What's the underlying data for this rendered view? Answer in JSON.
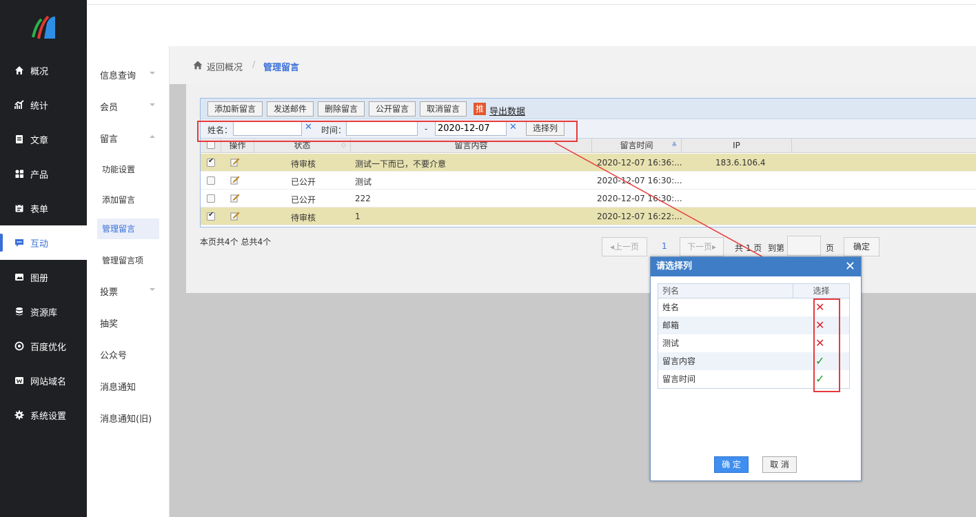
{
  "nav": {
    "items": [
      {
        "label": "概况",
        "icon": "home-icon"
      },
      {
        "label": "统计",
        "icon": "chart-icon"
      },
      {
        "label": "文章",
        "icon": "article-icon"
      },
      {
        "label": "产品",
        "icon": "grid-icon"
      },
      {
        "label": "表单",
        "icon": "form-icon"
      },
      {
        "label": "互动",
        "icon": "chat-icon"
      },
      {
        "label": "图册",
        "icon": "album-icon"
      },
      {
        "label": "资源库",
        "icon": "database-icon"
      },
      {
        "label": "百度优化",
        "icon": "seo-icon"
      },
      {
        "label": "网站域名",
        "icon": "domain-icon"
      },
      {
        "label": "系统设置",
        "icon": "gear-icon"
      }
    ],
    "active_index": 5
  },
  "subnav": {
    "info": "信息查询",
    "member": "会员",
    "message": "留言",
    "children": [
      "功能设置",
      "添加留言",
      "管理留言",
      "管理留言项"
    ],
    "vote": "投票",
    "lottery": "抽奖",
    "wechat": "公众号",
    "notice": "消息通知",
    "notice_old": "消息通知(旧)"
  },
  "breadcrumb": {
    "home": "返回概况",
    "sep": "/",
    "current": "管理留言"
  },
  "toolbar": {
    "add": "添加新留言",
    "email": "发送邮件",
    "delete": "删除留言",
    "publish": "公开留言",
    "unpublish": "取消留言",
    "export_badge": "推",
    "export": "导出数据"
  },
  "search": {
    "name_label": "姓名：",
    "time_label": "时间：",
    "dash": "-",
    "date_end": "2020-12-07",
    "choose_cols": "选择列"
  },
  "columns": {
    "op": "操作",
    "status": "状态",
    "content": "留言内容",
    "time": "留言时间",
    "ip": "IP"
  },
  "rows": [
    {
      "checked": true,
      "status": "待审核",
      "content": "测试一下而已，不要介意",
      "time": "2020-12-07 16:36:...",
      "ip": "183.6.106.4"
    },
    {
      "checked": false,
      "status": "已公开",
      "content": "测试",
      "time": "2020-12-07 16:30:...",
      "ip": ""
    },
    {
      "checked": false,
      "status": "已公开",
      "content": "222",
      "time": "2020-12-07 16:30:...",
      "ip": ""
    },
    {
      "checked": true,
      "status": "待审核",
      "content": "1",
      "time": "2020-12-07 16:22:...",
      "ip": ""
    }
  ],
  "pager": {
    "summary": "本页共4个 总共4个",
    "prev": "上一页",
    "page": "1",
    "next": "下一页",
    "total": "共 1 页",
    "goto": "到第",
    "unit": "页",
    "confirm": "确定"
  },
  "dialog": {
    "title": "请选择列",
    "col_name": "列名",
    "col_select": "选择",
    "items": [
      {
        "label": "姓名",
        "selected": false
      },
      {
        "label": "邮箱",
        "selected": false
      },
      {
        "label": "测试",
        "selected": false
      },
      {
        "label": "留言内容",
        "selected": true
      },
      {
        "label": "留言时间",
        "selected": true
      }
    ],
    "ok": "确 定",
    "cancel": "取 消"
  },
  "colors": {
    "accent": "#3a6fd8",
    "sidebar": "#1e2023",
    "highlight": "#e8393b",
    "dialog_header": "#3f7ec7"
  }
}
